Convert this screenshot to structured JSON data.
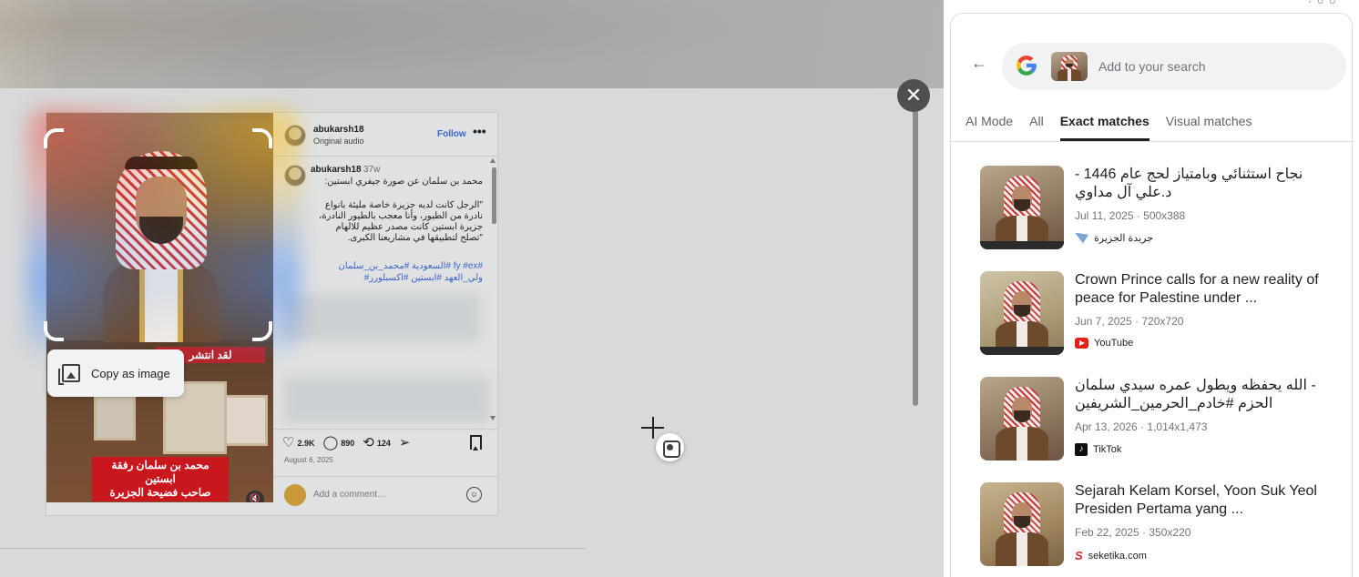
{
  "overlay": {
    "close_symbol": "✕"
  },
  "post": {
    "header": {
      "username": "abukarsh18",
      "audio": "Original audio",
      "follow": "Follow",
      "more": "•••"
    },
    "media": {
      "banner": "لقد انتشر",
      "caption_line1": "محمد بن سلمان رفقة ابستين",
      "caption_line2": "صاحب فضيحة الجزيرة"
    },
    "caption": {
      "username": "abukarsh18",
      "time": "37w",
      "line1": "محمد بن سلمان عن صورة جيفري ابستين:",
      "body": "\"الرجل كانت لديه جزيرة خاصة مليئة بانواع\nنادرة من الطيور، وأنا معجب بالطيور النادرة،\nجزيرة ابستين كانت مصدر عظيم للالهام\n\"تصلح لتطبيقها في مشاريعنا الكبرى.",
      "tags_line1": "#fy #ex #السعودية #محمد_بن_سلمان",
      "tags_line2": "ولي_العهد #ابستين #اكسبلورر#"
    },
    "actions": {
      "likes": "2.9K",
      "comments": "890",
      "reposts": "124"
    },
    "date": "August 6, 2025",
    "comment_placeholder": "Add a comment…"
  },
  "context_menu": {
    "copy_image": "Copy as image"
  },
  "lens": {
    "search_placeholder": "Add to your search",
    "tabs": [
      {
        "label": "AI Mode",
        "active": false
      },
      {
        "label": "All",
        "active": false
      },
      {
        "label": "Exact matches",
        "active": true
      },
      {
        "label": "Visual matches",
        "active": false
      }
    ],
    "results": [
      {
        "title": "نجاح استثنائي وبامتياز لحج عام 1446 - د.علي آل مداوي",
        "date": "Jul 11, 2025",
        "size": "500x388",
        "meta": "Jul 11, 2025 · 500x388",
        "source": "جريدة الجزيرة",
        "source_icon": "al-jazirah-icon"
      },
      {
        "title": "Crown Prince calls for a new reality of peace for Palestine under ...",
        "date": "Jun 7, 2025",
        "size": "720x720",
        "meta": "Jun 7, 2025 · 720x720",
        "source": "YouTube",
        "source_icon": "youtube-icon"
      },
      {
        "title": "- الله يحفظه ويطول عمره سيدي سلمان الحزم #خادم_الحرمين_الشريفين",
        "date": "Apr 13, 2026",
        "size": "1,014x1,473",
        "meta": "Apr 13, 2026 · 1,014x1,473",
        "source": "TikTok",
        "source_icon": "tiktok-icon"
      },
      {
        "title": "Sejarah Kelam Korsel, Yoon Suk Yeol Presiden Pertama yang ...",
        "date": "Feb 22, 2025",
        "size": "350x220",
        "meta": "Feb 22, 2025 · 350x220",
        "source": "seketika.com",
        "source_icon": "seketika-icon"
      }
    ]
  },
  "colors": {
    "google_blue": "#4285F4",
    "google_red": "#EA4335",
    "google_yellow": "#FBBC05",
    "google_green": "#34A853",
    "follow_blue": "#3a64c9"
  }
}
